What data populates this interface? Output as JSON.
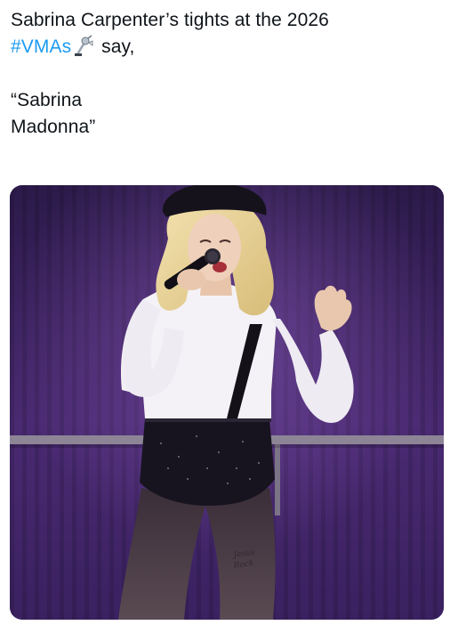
{
  "post": {
    "line1": "Sabrina Carpenter’s tights at the 2026",
    "hashtag": "#VMAs",
    "trophy_icon": "vma-moonman-icon",
    "line2_after": " say,",
    "quote_line1": "“Sabrina",
    "quote_line2": "Madonna”"
  },
  "media": {
    "kind": "photo",
    "tattoo_text": "Jesus Rock"
  },
  "colors": {
    "hashtag": "#1d9bf0",
    "text": "#0f1419",
    "stage_background": "#3a1e5c"
  }
}
